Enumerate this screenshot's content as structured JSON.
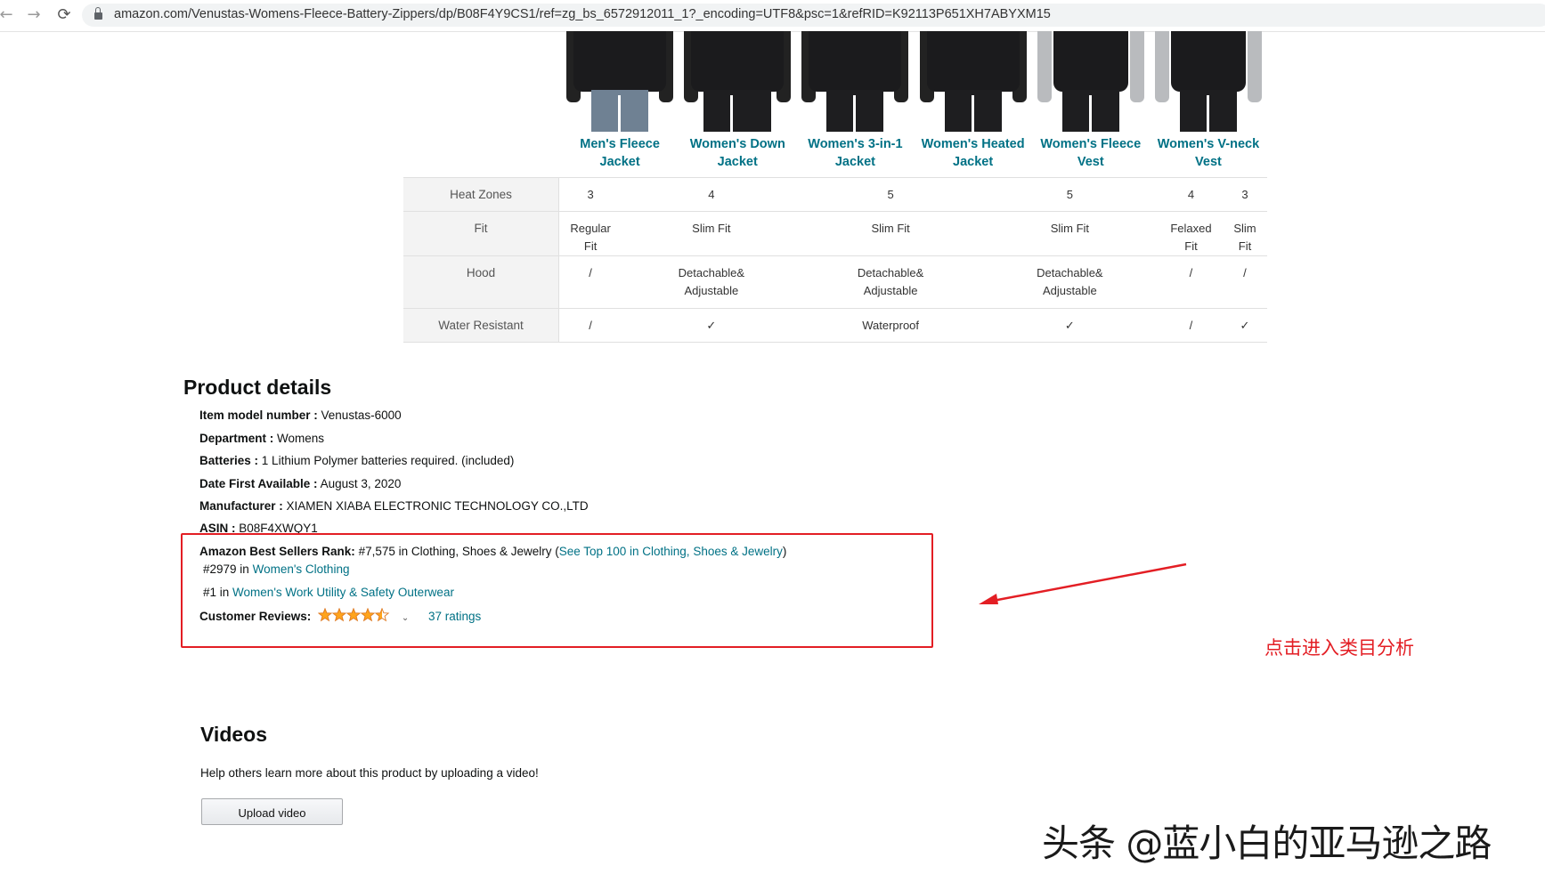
{
  "browser": {
    "back_glyph": "←",
    "forward_glyph": "→",
    "reload_glyph": "⟳",
    "url": "amazon.com/Venustas-Womens-Fleece-Battery-Zippers/dp/B08F4Y9CS1/ref=zg_bs_6572912011_1?_encoding=UTF8&psc=1&refRID=K92113P651XH7ABYXM15"
  },
  "comparison": {
    "products": [
      {
        "name_line1": "Men's Fleece",
        "name_line2": "Jacket"
      },
      {
        "name_line1": "Women's Down",
        "name_line2": "Jacket"
      },
      {
        "name_line1": "Women's 3-in-1",
        "name_line2": "Jacket"
      },
      {
        "name_line1": "Women's Heated",
        "name_line2": "Jacket"
      },
      {
        "name_line1": "Women's Fleece",
        "name_line2": "Vest"
      },
      {
        "name_line1": "Women's V-neck",
        "name_line2": "Vest"
      }
    ],
    "rows": [
      {
        "label": "Heat Zones",
        "cells": [
          "3",
          "4",
          "5",
          "5",
          "4",
          "3"
        ]
      },
      {
        "label": "Fit",
        "cells": [
          "Regular Fit",
          "Slim Fit",
          "Slim Fit",
          "Slim Fit",
          "Felaxed Fit",
          "Slim Fit"
        ]
      },
      {
        "label": "Hood",
        "cells": [
          "/",
          "Detachable& Adjustable",
          "Detachable& Adjustable",
          "Detachable& Adjustable",
          "/",
          "/"
        ]
      },
      {
        "label": "Water Resistant",
        "cells": [
          "/",
          "✓",
          "Waterproof",
          "✓",
          "/",
          "✓"
        ]
      }
    ]
  },
  "product_details": {
    "title": "Product details",
    "model_label": "Item model number :",
    "model_value": "Venustas-6000",
    "department_label": "Department :",
    "department_value": "Womens",
    "batteries_label": "Batteries :",
    "batteries_value": "1 Lithium Polymer batteries required. (included)",
    "date_label": "Date First Available :",
    "date_value": "August 3, 2020",
    "manufacturer_label": "Manufacturer :",
    "manufacturer_value": "XIAMEN XIABA ELECTRONIC TECHNOLOGY CO.,LTD",
    "asin_label": "ASIN :",
    "asin_value": "B08F4XWQY1",
    "bsr_label": "Amazon Best Sellers Rank:",
    "bsr_value": "#7,575 in Clothing, Shoes & Jewelry (",
    "bsr_link": "See Top 100 in Clothing, Shoes & Jewelry",
    "bsr_close": ")",
    "rank2_prefix": "#2979 in",
    "rank2_link": "Women's Clothing",
    "rank3_prefix": "#1 in",
    "rank3_link": "Women's Work Utility & Safety Outerwear",
    "reviews_label": "Customer Reviews:",
    "rating_stars": 4.5,
    "chevron_glyph": "⌄",
    "ratings_link": "37 ratings"
  },
  "annotation": {
    "text": "点击进入类目分析",
    "color": "#e31e24"
  },
  "videos": {
    "title": "Videos",
    "help": "Help others learn more about this product by uploading a video!",
    "upload_label": "Upload video"
  },
  "watermark": "头条 @蓝小白的亚马逊之路",
  "colors": {
    "link": "#007185",
    "annotation_red": "#e31e24",
    "star": "#ffa41c"
  }
}
